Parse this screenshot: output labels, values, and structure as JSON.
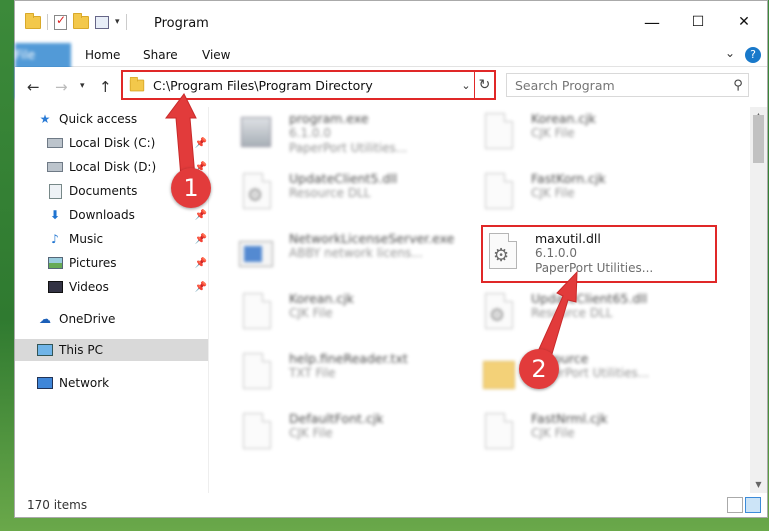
{
  "window": {
    "title": "Program",
    "controls": {
      "minimize": "—",
      "maximize": "☐",
      "close": "✕"
    }
  },
  "ribbon": {
    "tabs": [
      "File",
      "Home",
      "Share",
      "View"
    ],
    "help": "?"
  },
  "nav": {
    "address": "C:\\Program Files\\Program Directory",
    "search_placeholder": "Search Program"
  },
  "sidebar": {
    "items": [
      {
        "label": "Quick access",
        "icon": "star-icon"
      },
      {
        "label": "Local Disk (C:)",
        "icon": "disk-icon",
        "pinned": true
      },
      {
        "label": "Local Disk (D:)",
        "icon": "disk-icon",
        "pinned": true
      },
      {
        "label": "Documents",
        "icon": "documents-icon",
        "pinned": true
      },
      {
        "label": "Downloads",
        "icon": "download-icon",
        "pinned": true
      },
      {
        "label": "Music",
        "icon": "music-icon",
        "pinned": true
      },
      {
        "label": "Pictures",
        "icon": "pictures-icon",
        "pinned": true
      },
      {
        "label": "Videos",
        "icon": "videos-icon",
        "pinned": true
      },
      {
        "label": "OneDrive",
        "icon": "cloud-icon"
      },
      {
        "label": "This PC",
        "icon": "computer-icon",
        "selected": true
      },
      {
        "label": "Network",
        "icon": "network-icon"
      }
    ]
  },
  "files": [
    {
      "name": "program.exe",
      "line2": "6.1.0.0",
      "line3": "PaperPort Utilities...",
      "icon": "exe-icon"
    },
    {
      "name": "Korean.cjk",
      "line2": "CJK File",
      "line3": "",
      "icon": "document-icon"
    },
    {
      "name": "UpdateClient5.dll",
      "line2": "Resource DLL",
      "line3": "",
      "icon": "dll-icon"
    },
    {
      "name": "FastKorn.cjk",
      "line2": "CJK File",
      "line3": "",
      "icon": "document-icon"
    },
    {
      "name": "NetworkLicenseServer.exe",
      "line2": "ABBY network licens...",
      "line3": "",
      "icon": "network-exe-icon"
    },
    {
      "name": "maxutil.dll",
      "line2": "6.1.0.0",
      "line3": "PaperPort Utilities...",
      "icon": "dll-icon"
    },
    {
      "name": "Korean.cjk",
      "line2": "CJK File",
      "line3": "",
      "icon": "document-icon"
    },
    {
      "name": "UpdateClient65.dll",
      "line2": "Resource DLL",
      "line3": "",
      "icon": "dll-icon"
    },
    {
      "name": "help.fineReader.txt",
      "line2": "TXT File",
      "line3": "",
      "icon": "document-icon"
    },
    {
      "name": "Resource",
      "line2": "PaperPort Utilities...",
      "line3": "",
      "icon": "folder-icon"
    },
    {
      "name": "DefaultFont.cjk",
      "line2": "CJK File",
      "line3": "",
      "icon": "document-icon"
    },
    {
      "name": "FastNrml.cjk",
      "line2": "CJK File",
      "line3": "",
      "icon": "document-icon"
    }
  ],
  "status": {
    "count": "170 items"
  },
  "annotations": {
    "badge1": "1",
    "badge2": "2"
  },
  "colors": {
    "accent": "#1979ca",
    "highlight": "#e02828",
    "badge": "#e23b3b"
  }
}
